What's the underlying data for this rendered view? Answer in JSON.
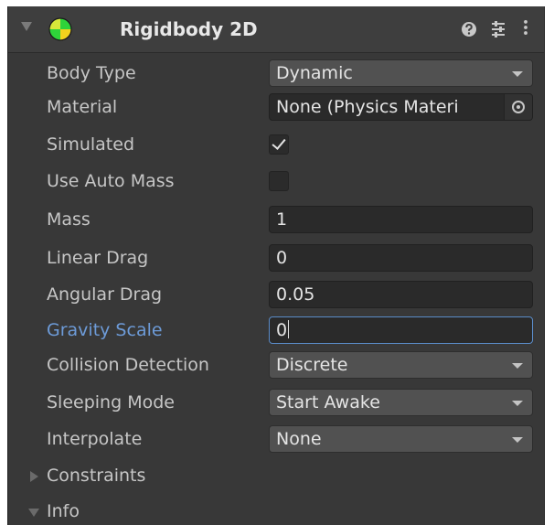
{
  "component": {
    "title": "Rigidbody 2D",
    "icons": {
      "foldout": "foldout-expanded-icon",
      "component": "rigidbody2d-icon",
      "help": "help-icon",
      "presets": "presets-icon",
      "menu": "kebab-menu-icon"
    },
    "colors": {
      "panel": "#383838",
      "field": "#2a2a2a",
      "dropdown": "#515151",
      "label": "#c6c6c6",
      "focused_label": "#6d9bd8",
      "focus_border": "#5a8bc7",
      "icon_green": "#2fd33a",
      "icon_yellow": "#f2d31d"
    }
  },
  "fields": {
    "body_type": {
      "label": "Body Type",
      "value": "Dynamic"
    },
    "material": {
      "label": "Material",
      "value": "None (Physics Materi"
    },
    "simulated": {
      "label": "Simulated",
      "checked": true
    },
    "use_auto_mass": {
      "label": "Use Auto Mass",
      "checked": false
    },
    "mass": {
      "label": "Mass",
      "value": "1"
    },
    "linear_drag": {
      "label": "Linear Drag",
      "value": "0"
    },
    "angular_drag": {
      "label": "Angular Drag",
      "value": "0.05"
    },
    "gravity_scale": {
      "label": "Gravity Scale",
      "value": "0"
    },
    "collision_detection": {
      "label": "Collision Detection",
      "value": "Discrete"
    },
    "sleeping_mode": {
      "label": "Sleeping Mode",
      "value": "Start Awake"
    },
    "interpolate": {
      "label": "Interpolate",
      "value": "None"
    }
  },
  "foldouts": {
    "constraints": {
      "label": "Constraints",
      "expanded": false
    },
    "info": {
      "label": "Info",
      "expanded": true
    }
  }
}
